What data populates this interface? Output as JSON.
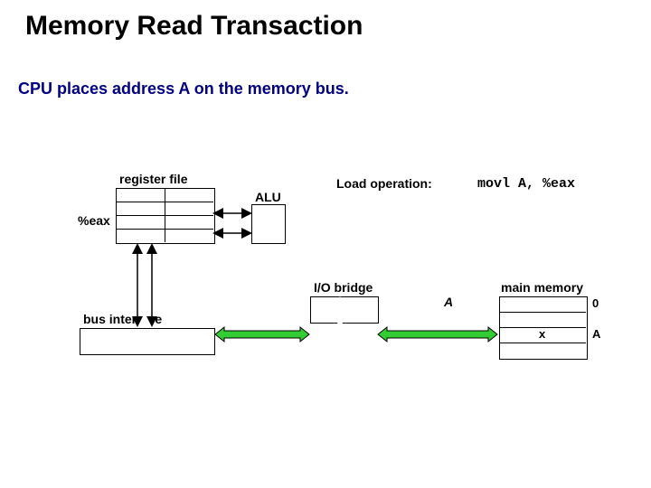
{
  "title": "Memory Read Transaction",
  "subtitle": "CPU places address A on the memory bus.",
  "labels": {
    "register_file": "register file",
    "eax": "%eax",
    "alu": "ALU",
    "load_operation": "Load operation:",
    "io_bridge": "I/O bridge",
    "bus_interface": "bus interface",
    "main_memory": "main memory",
    "zero": "0",
    "x": "x",
    "a_right": "A",
    "a_bus": "A"
  },
  "code": {
    "movl": "movl A, %eax"
  }
}
